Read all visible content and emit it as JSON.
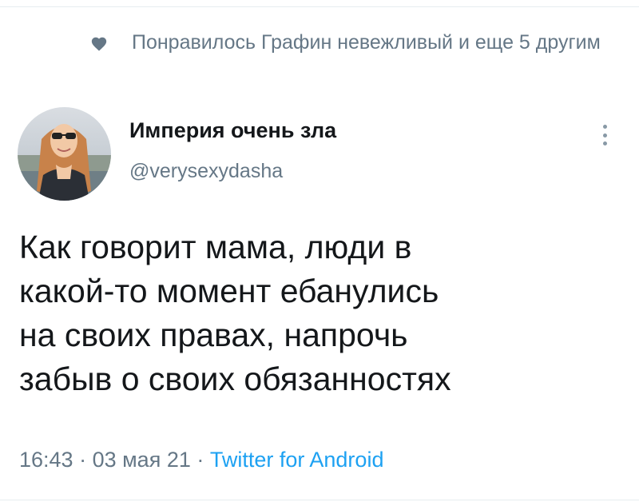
{
  "social_context": {
    "icon": "heart-icon",
    "text": "Понравилось Графин невежливый и еще 5 другим"
  },
  "author": {
    "avatar_icon": "avatar",
    "name": "Империя очень зла",
    "handle": "@verysexydasha"
  },
  "tweet": {
    "text": "Как говорит мама, люди в\nкакой-то момент ебанулись\nна своих правах, напрочь\nзабыв о своих обязанностях"
  },
  "meta": {
    "time": "16:43",
    "separator": " · ",
    "date": "03 мая 21",
    "source": "Twitter for Android"
  },
  "colors": {
    "secondary_text": "#657786",
    "link": "#1da1f2",
    "primary_text": "#14171a",
    "divider": "#e6ecf0"
  }
}
